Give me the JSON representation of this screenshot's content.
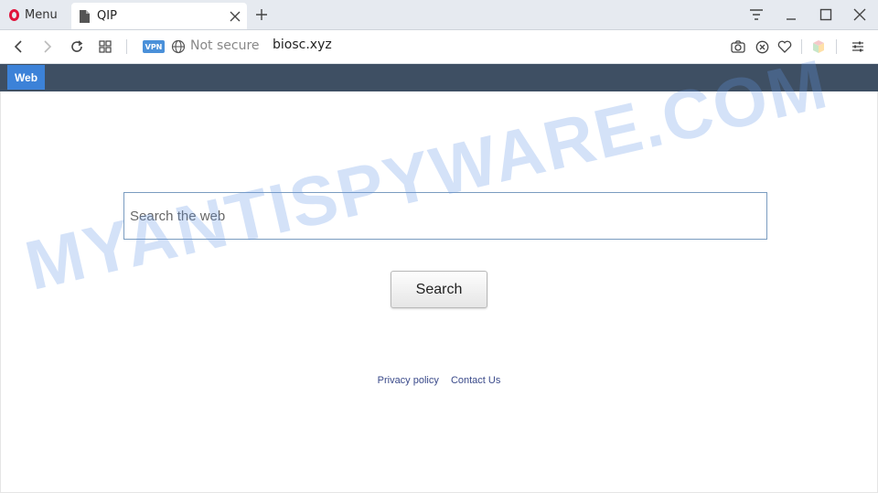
{
  "browser": {
    "menu_label": "Menu",
    "tab_title": "QIP",
    "vpn_badge": "VPN",
    "security_label": "Not secure",
    "url": "biosc.xyz"
  },
  "site": {
    "nav_tab": "Web",
    "search_placeholder": "Search the web",
    "search_button": "Search",
    "footer": {
      "privacy": "Privacy policy",
      "contact": "Contact Us"
    }
  },
  "watermark_text": "MYANTISPYWARE.COM",
  "colors": {
    "header_bg": "#3e4f63",
    "nav_tab_bg": "#3c82d8",
    "opera_red": "#e0143c",
    "link": "#3a4a8a"
  }
}
